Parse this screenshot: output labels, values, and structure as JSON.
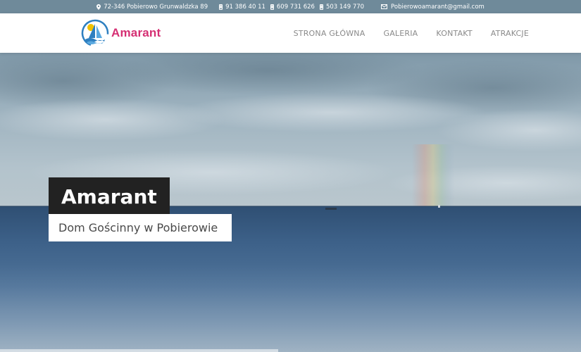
{
  "topbar": {
    "address": "72-346 Pobierowo Grunwaldzka 89",
    "phones": [
      "91 386 40 11",
      "609 731 626",
      "503 149 770"
    ],
    "email": "Pobierowoamarant@gmail.com",
    "icons": {
      "address": "map-marker-icon",
      "phone": "mobile-phone-icon",
      "email": "envelope-icon"
    }
  },
  "brand": {
    "name": "Amarant",
    "color": "#d52f73"
  },
  "nav": {
    "items": [
      "STRONA GŁÓWNA",
      "GALERIA",
      "KONTAKT",
      "ATRAKCJE"
    ]
  },
  "hero": {
    "title": "Amarant",
    "subtitle": "Dom Gościnny w Pobierowie"
  },
  "colors": {
    "topbar": "#6f8a9a",
    "nav_text": "#8a8a8a",
    "title_bg": "#222222"
  }
}
